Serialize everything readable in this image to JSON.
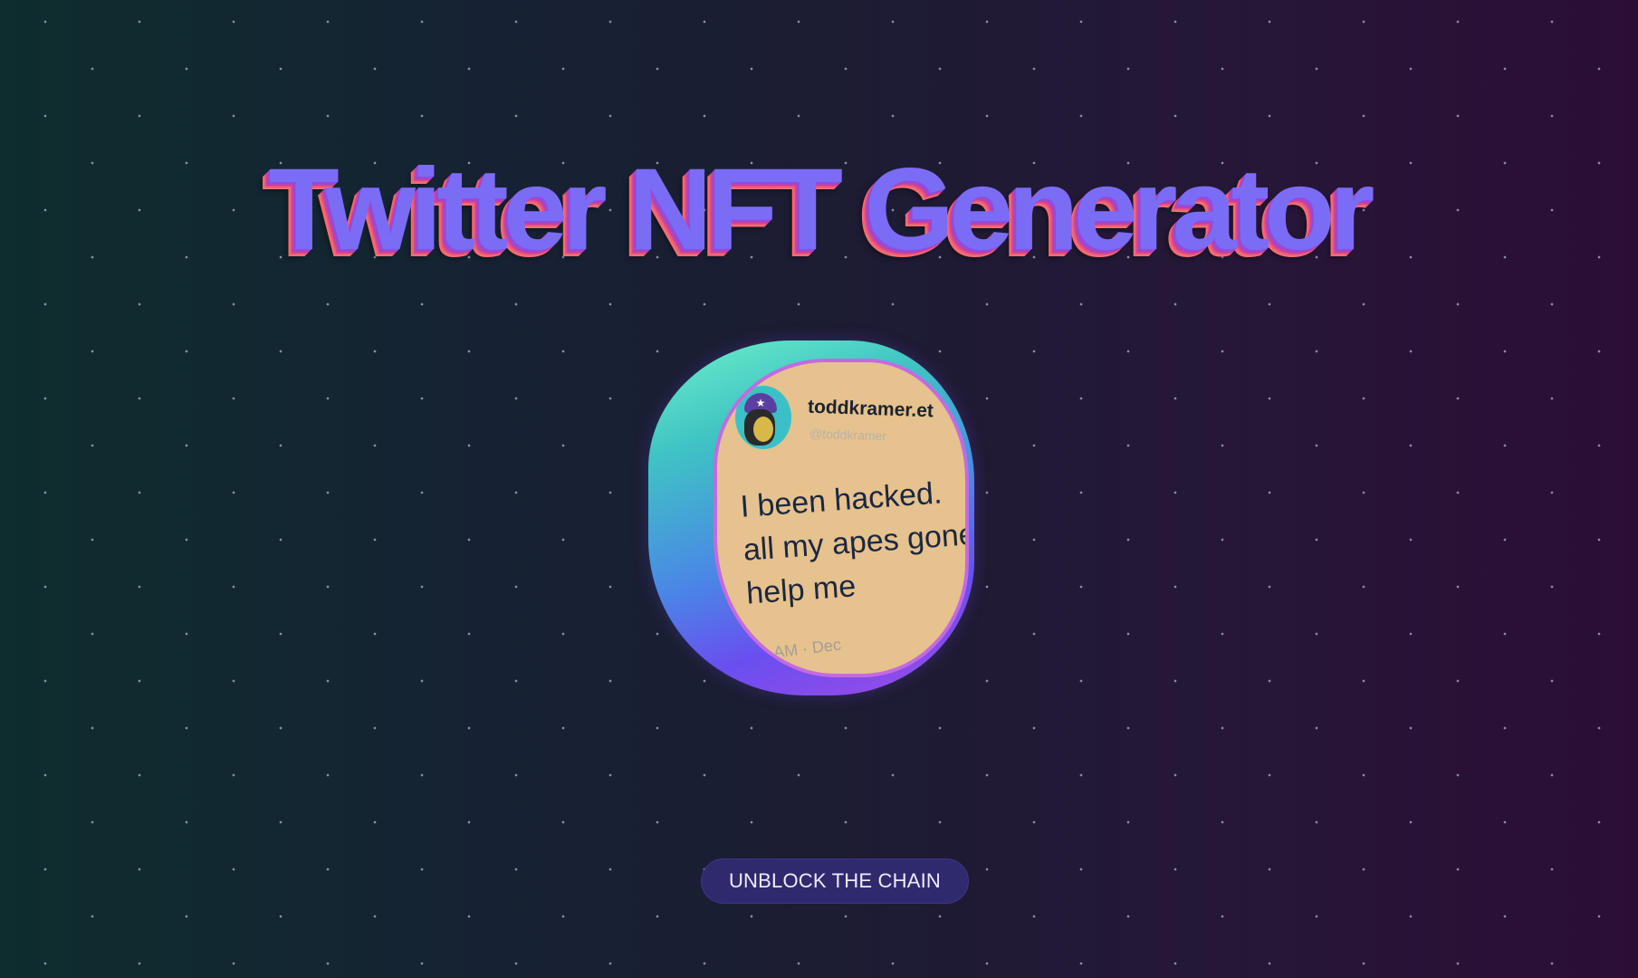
{
  "page": {
    "title": "Twitter NFT Generator"
  },
  "coin": {
    "display_name": "toddkramer.et",
    "handle": "@toddkramer",
    "tweet_lines": [
      "I been hacked.",
      "all my apes gone. t",
      "help me"
    ],
    "timestamp": "AM · Dec"
  },
  "cta": {
    "label": "UNBLOCK THE CHAIN"
  },
  "colors": {
    "title_face": "#7b6cf6",
    "title_extrude": "#f7716e",
    "coin_face": "#e6c28e",
    "coin_edge_top": "#6ef0c8",
    "coin_edge_bottom": "#a04ae6",
    "button_bg": "#2f2a6e"
  },
  "icons": {
    "avatar": "bored-ape-avatar-icon"
  }
}
